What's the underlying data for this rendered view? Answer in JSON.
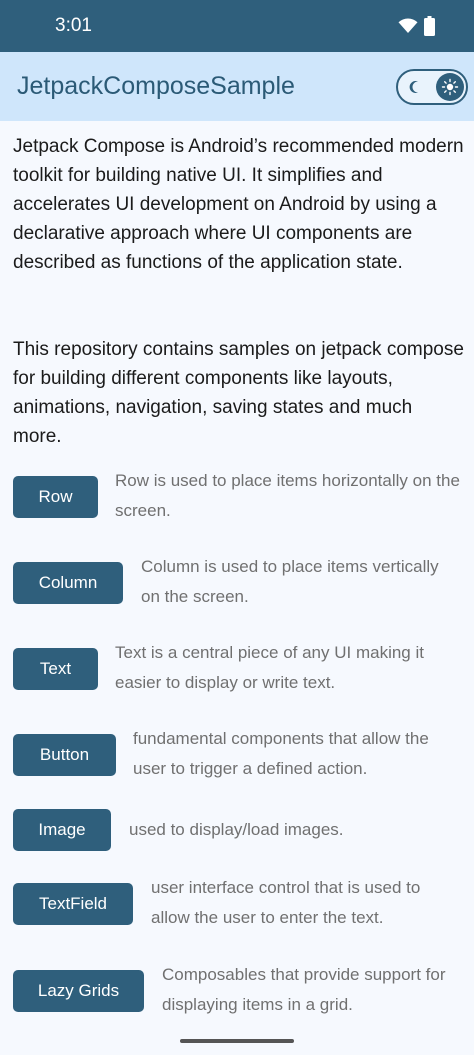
{
  "status_bar": {
    "time": "3:01"
  },
  "app_bar": {
    "title": "JetpackComposeSample"
  },
  "intro": {
    "paragraph1": "Jetpack Compose is Android’s recommended modern toolkit for building native UI. It simplifies and accelerates UI development on Android by using a declarative approach where UI components are described as functions of the application state.",
    "paragraph2": "This repository contains samples on jetpack compose for building different components like layouts, animations, navigation, saving states and much more."
  },
  "components": [
    {
      "label": "Row",
      "description": "Row is used to place items horizontally on the screen."
    },
    {
      "label": "Column",
      "description": "Column is used to place items vertically on the screen."
    },
    {
      "label": "Text",
      "description": "Text is a central piece of any UI making it easier to display or write text."
    },
    {
      "label": "Button",
      "description": "fundamental components that allow the user to trigger a defined action."
    },
    {
      "label": "Image",
      "description": "used to display/load images."
    },
    {
      "label": "TextField",
      "description": "user interface control that is used to allow the user to enter the text."
    },
    {
      "label": "Lazy Grids",
      "description": "Composables that provide support for displaying items in a grid."
    }
  ],
  "colors": {
    "primary": "#2f5f7c",
    "app_bar_bg": "#cfe6fb",
    "background": "#f6f9fe",
    "description_text": "#707070"
  },
  "icons": {
    "wifi": "wifi-icon",
    "battery": "battery-icon",
    "theme_light": "sun-icon",
    "theme_dark": "moon-icon"
  }
}
